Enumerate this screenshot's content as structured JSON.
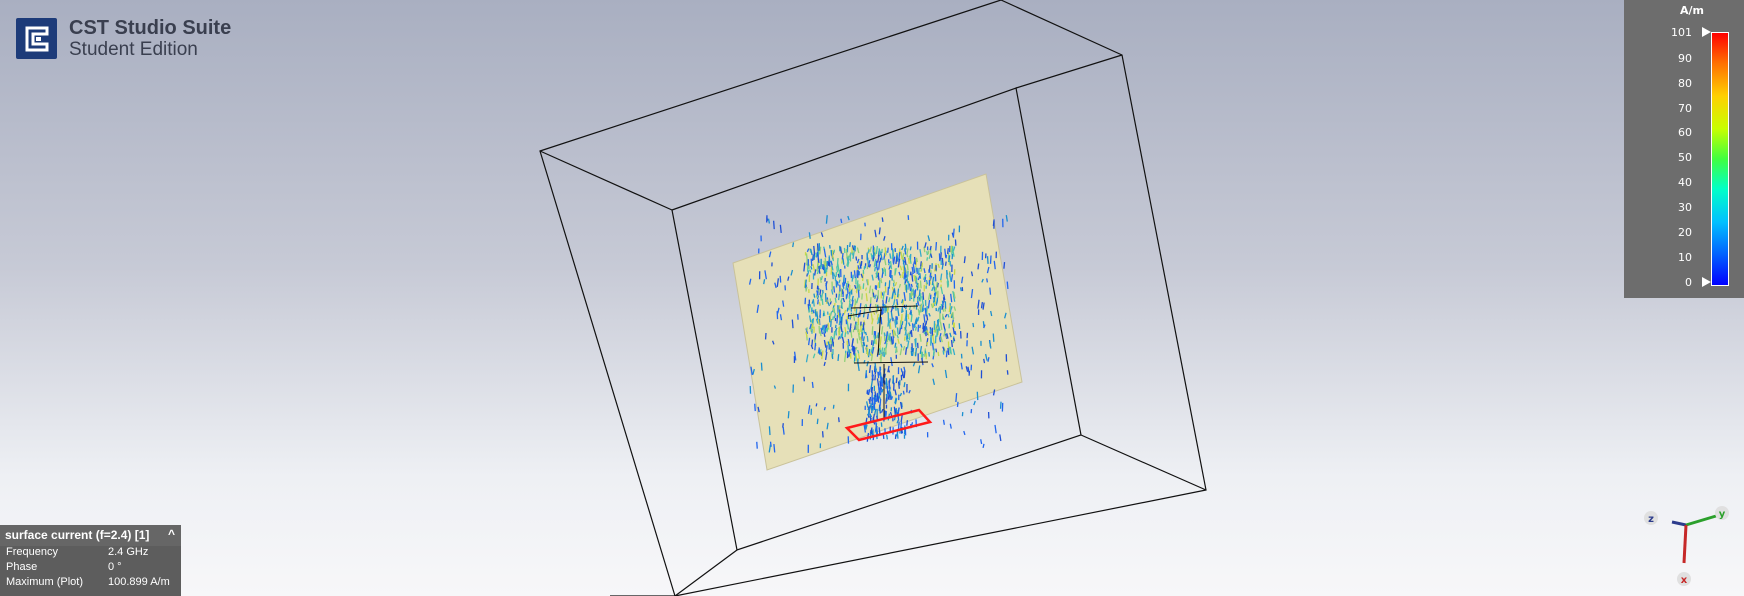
{
  "logo": {
    "title": "CST Studio Suite",
    "subtitle": "Student Edition",
    "mark_color": "#1d3b79"
  },
  "legend": {
    "unit": "A/m",
    "ticks": [
      "101",
      "90",
      "80",
      "70",
      "60",
      "50",
      "40",
      "30",
      "20",
      "10",
      "0"
    ],
    "max_value": 101,
    "min_value": 0
  },
  "info_panel": {
    "title": "surface current (f=2.4) [1]",
    "chevron": "^",
    "rows": [
      {
        "key": "Frequency",
        "value": "2.4 GHz"
      },
      {
        "key": "Phase",
        "value": "0 °"
      },
      {
        "key": "Maximum (Plot)",
        "value": "100.899 A/m"
      }
    ]
  },
  "axes_widget": {
    "x": "x",
    "y": "y",
    "z": "z"
  },
  "colors": {
    "substrate": "#e6e0b8",
    "port": "#ff1a1a",
    "bbox": "#111111"
  }
}
